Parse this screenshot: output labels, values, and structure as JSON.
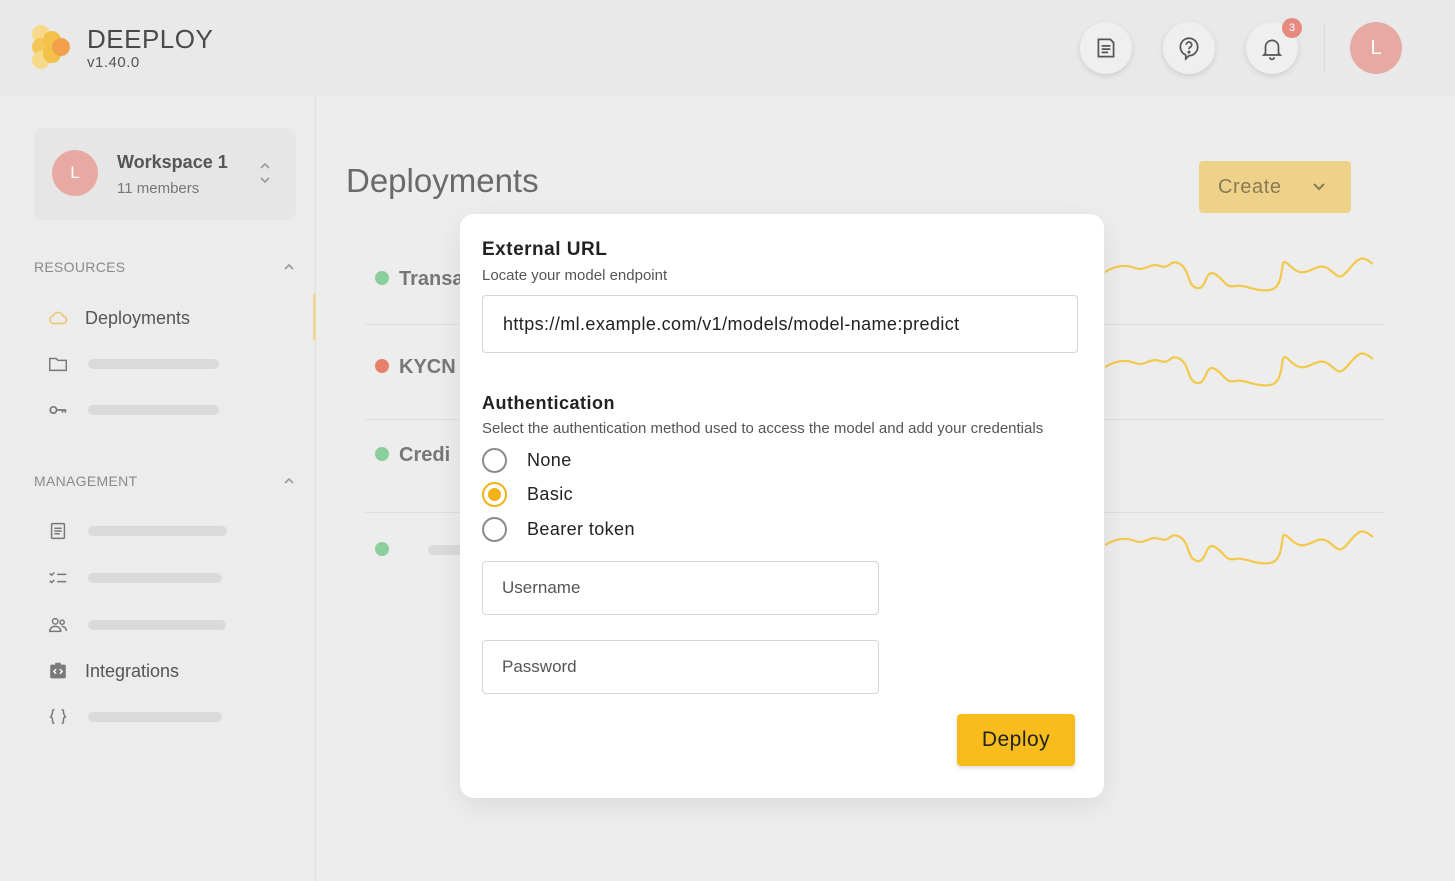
{
  "app": {
    "brand": "DEEPLOY",
    "version": "v1.40.0"
  },
  "header": {
    "notification_count": "3",
    "avatar_initial": "L"
  },
  "workspace": {
    "avatar_initial": "L",
    "name": "Workspace 1",
    "members": "11 members"
  },
  "sidebar": {
    "resources_label": "RESOURCES",
    "management_label": "MANAGEMENT",
    "deployments_label": "Deployments",
    "integrations_label": "Integrations"
  },
  "main": {
    "title": "Deployments",
    "create_label": "Create",
    "rows": [
      {
        "name": "Transa",
        "status_color": "#8ccf9e"
      },
      {
        "name": "KYCN",
        "status_color": "#e6826a"
      },
      {
        "name": "Credi",
        "status_color": "#8ccf9e"
      },
      {
        "name": "",
        "status_color": "#8ccf9e"
      }
    ]
  },
  "modal": {
    "url_title": "External URL",
    "url_subtitle": "Locate your model endpoint",
    "url_value": "https://ml.example.com/v1/models/model-name:predict",
    "auth_title": "Authentication",
    "auth_subtitle": "Select the authentication method used to access the model and add your credentials",
    "auth_options": [
      {
        "label": "None",
        "checked": false
      },
      {
        "label": "Basic",
        "checked": true
      },
      {
        "label": "Bearer token",
        "checked": false
      }
    ],
    "username_placeholder": "Username",
    "password_placeholder": "Password",
    "deploy_label": "Deploy"
  },
  "colors": {
    "accent": "#f8bd1c",
    "sparkline": "#f2c94c"
  }
}
